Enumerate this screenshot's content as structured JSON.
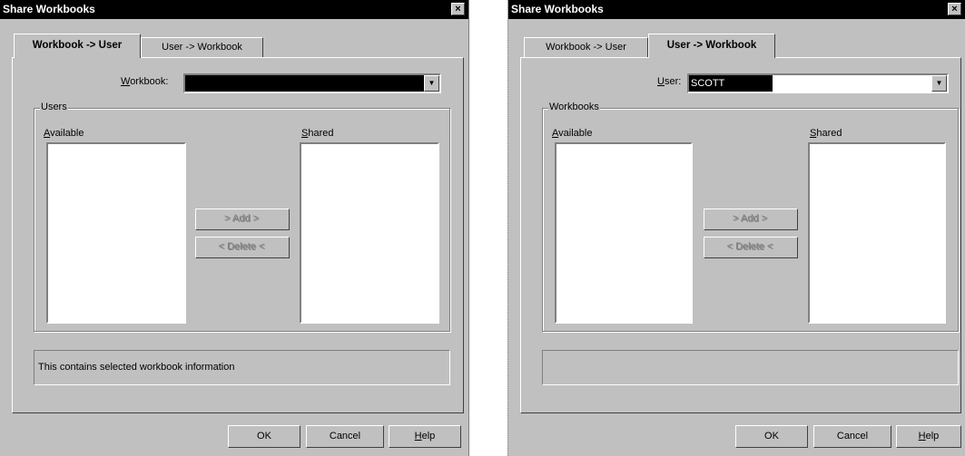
{
  "dialog1": {
    "title": "Share Workbooks",
    "close_glyph": "×",
    "tabs": [
      {
        "label": "Workbook -> User"
      },
      {
        "label": "User -> Workbook"
      }
    ],
    "selector": {
      "label_u": "W",
      "label_rest": "orkbook:",
      "value": ""
    },
    "group_label": "Users",
    "available": {
      "label_u": "A",
      "label_rest": "vailable"
    },
    "shared": {
      "label_u": "S",
      "label_rest": "hared"
    },
    "add_label": "> Add >",
    "delete_label": "< Delete <",
    "status_text": "This contains selected workbook information",
    "ok_label": "OK",
    "cancel_label": "Cancel",
    "help_label": "Help"
  },
  "dialog2": {
    "title": "Share Workbooks",
    "close_glyph": "×",
    "tabs": [
      {
        "label": "Workbook -> User"
      },
      {
        "label": "User -> Workbook"
      }
    ],
    "selector": {
      "label_u": "U",
      "label_rest": "ser:",
      "value": "SCOTT"
    },
    "group_label": "Workbooks",
    "available": {
      "label_u": "A",
      "label_rest": "vailable"
    },
    "shared": {
      "label_u": "S",
      "label_rest": "hared"
    },
    "add_label": "> Add >",
    "delete_label": "< Delete <",
    "status_text": "",
    "ok_label": "OK",
    "cancel_label": "Cancel",
    "help_label": "Help"
  },
  "icons": {
    "dropdown_arrow": "▼"
  }
}
